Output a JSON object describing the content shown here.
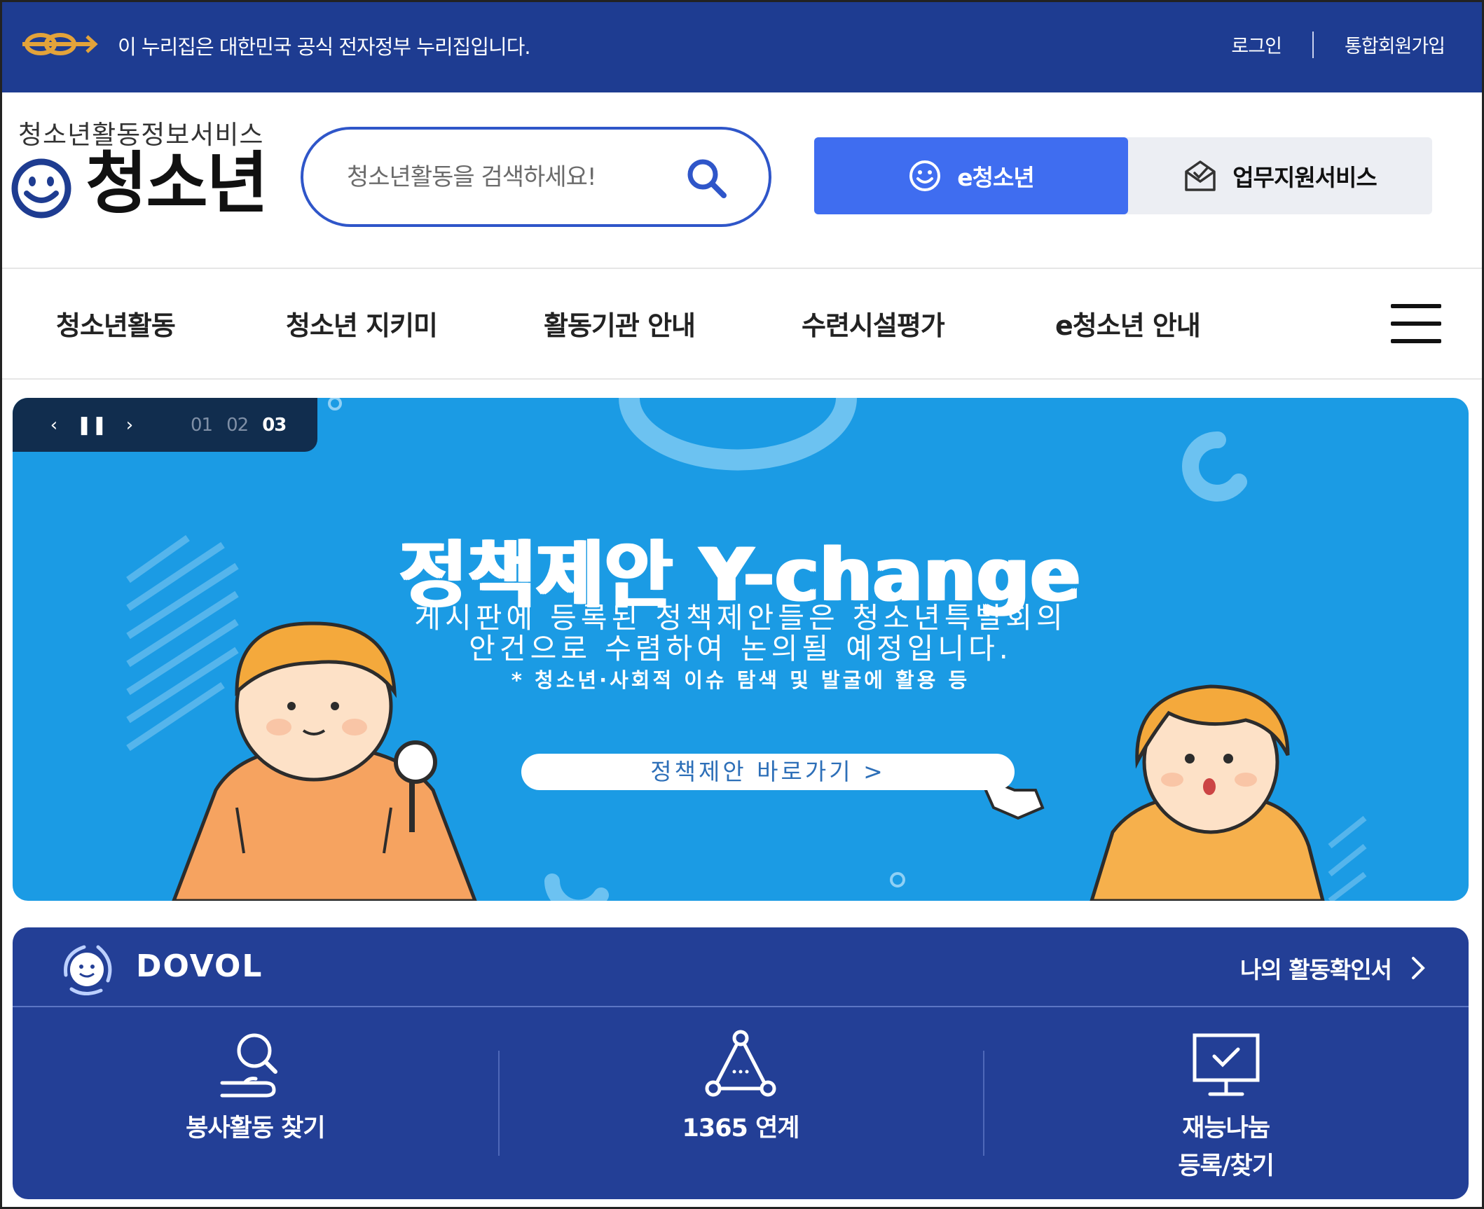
{
  "gov_bar": {
    "notice": "이 누리집은 대한민국 공식 전자정부 누리집입니다.",
    "login": "로그인",
    "signup": "통합회원가입"
  },
  "header": {
    "brand_sub": "청소년활동정보서비스",
    "brand_title": "청소년",
    "search_placeholder": "청소년활동을 검색하세요!",
    "tabs": [
      {
        "label": "e청소년",
        "icon": "smile-icon",
        "active": true
      },
      {
        "label": "업무지원서비스",
        "icon": "check-mail-icon",
        "active": false
      }
    ]
  },
  "nav": {
    "items": [
      "청소년활동",
      "청소년 지키미",
      "활동기관 안내",
      "수련시설평가",
      "e청소년 안내"
    ]
  },
  "banner": {
    "slides": [
      "01",
      "02",
      "03"
    ],
    "current_slide": "03",
    "title": "정책제안 Y-change",
    "desc_line1": "게시판에 등록된 정책제안들은 청소년특별회의",
    "desc_line2": "안건으로 수렴하여 논의될 예정입니다.",
    "note": "* 청소년·사회적 이슈 탐색 및 발굴에 활용 등",
    "cta": "정책제안 바로가기 >"
  },
  "dovol": {
    "title": "DOVOL",
    "link": "나의 활동확인서",
    "items": [
      {
        "label": "봉사활동 찾기",
        "icon": "search-hand-icon"
      },
      {
        "label": "1365 연계",
        "icon": "network-icon"
      },
      {
        "label_line1": "재능나눔",
        "label_line2": "등록/찾기",
        "icon": "monitor-check-icon"
      }
    ]
  },
  "colors": {
    "gov_bar": "#1e3c91",
    "accent": "#3f6df0",
    "banner_bg": "#1b9be4",
    "dovol_bg": "#233f96"
  }
}
